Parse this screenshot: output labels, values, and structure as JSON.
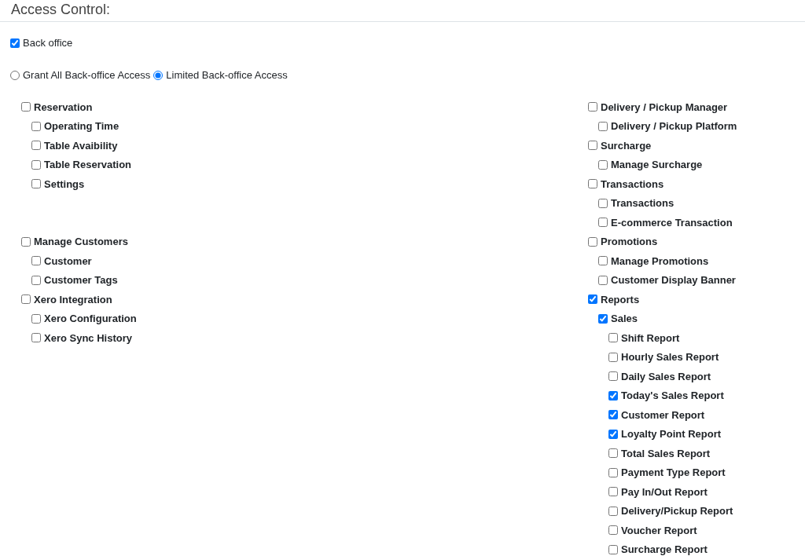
{
  "title": "Access Control:",
  "back_office": {
    "label": "Back office",
    "checked": true
  },
  "access_mode": [
    {
      "label": "Grant All Back-office Access",
      "selected": false
    },
    {
      "label": "Limited Back-office Access",
      "selected": true
    }
  ],
  "sections": [
    {
      "columns": [
        [
          {
            "label": "Reservation",
            "checked": false,
            "children": [
              {
                "label": "Operating Time",
                "checked": false
              },
              {
                "label": "Table Avaibility",
                "checked": false
              },
              {
                "label": "Table Reservation",
                "checked": false
              },
              {
                "label": "Settings",
                "checked": false
              }
            ]
          }
        ],
        [
          {
            "label": "Delivery / Pickup Manager",
            "checked": false,
            "children": [
              {
                "label": "Delivery / Pickup Platform",
                "checked": false
              }
            ]
          },
          {
            "label": "Surcharge",
            "checked": false,
            "children": [
              {
                "label": "Manage Surcharge",
                "checked": false
              }
            ]
          },
          {
            "label": "Transactions",
            "checked": false,
            "children": [
              {
                "label": "Transactions",
                "checked": false
              },
              {
                "label": "E-commerce Transaction",
                "checked": false
              }
            ]
          }
        ]
      ]
    },
    {
      "columns": [
        [
          {
            "label": "Manage Customers",
            "checked": false,
            "children": [
              {
                "label": "Customer",
                "checked": false
              },
              {
                "label": "Customer Tags",
                "checked": false
              }
            ]
          },
          {
            "label": "Xero Integration",
            "checked": false,
            "children": [
              {
                "label": "Xero Configuration",
                "checked": false
              },
              {
                "label": "Xero Sync History",
                "checked": false
              }
            ]
          }
        ],
        [
          {
            "label": "Promotions",
            "checked": false,
            "children": [
              {
                "label": "Manage Promotions",
                "checked": false
              },
              {
                "label": "Customer Display Banner",
                "checked": false
              }
            ]
          },
          {
            "label": "Reports",
            "checked": true,
            "children": [
              {
                "label": "Sales",
                "checked": true,
                "children": [
                  {
                    "label": "Shift Report",
                    "checked": false
                  },
                  {
                    "label": "Hourly Sales Report",
                    "checked": false
                  },
                  {
                    "label": "Daily Sales Report",
                    "checked": false
                  },
                  {
                    "label": "Today's Sales Report",
                    "checked": true
                  },
                  {
                    "label": "Customer Report",
                    "checked": true
                  },
                  {
                    "label": "Loyalty Point Report",
                    "checked": true
                  },
                  {
                    "label": "Total Sales Report",
                    "checked": false
                  },
                  {
                    "label": "Payment Type Report",
                    "checked": false
                  },
                  {
                    "label": "Pay In/Out Report",
                    "checked": false
                  },
                  {
                    "label": "Delivery/Pickup Report",
                    "checked": false
                  },
                  {
                    "label": "Voucher Report",
                    "checked": false
                  },
                  {
                    "label": "Surcharge Report",
                    "checked": false
                  }
                ]
              }
            ]
          }
        ]
      ]
    }
  ]
}
